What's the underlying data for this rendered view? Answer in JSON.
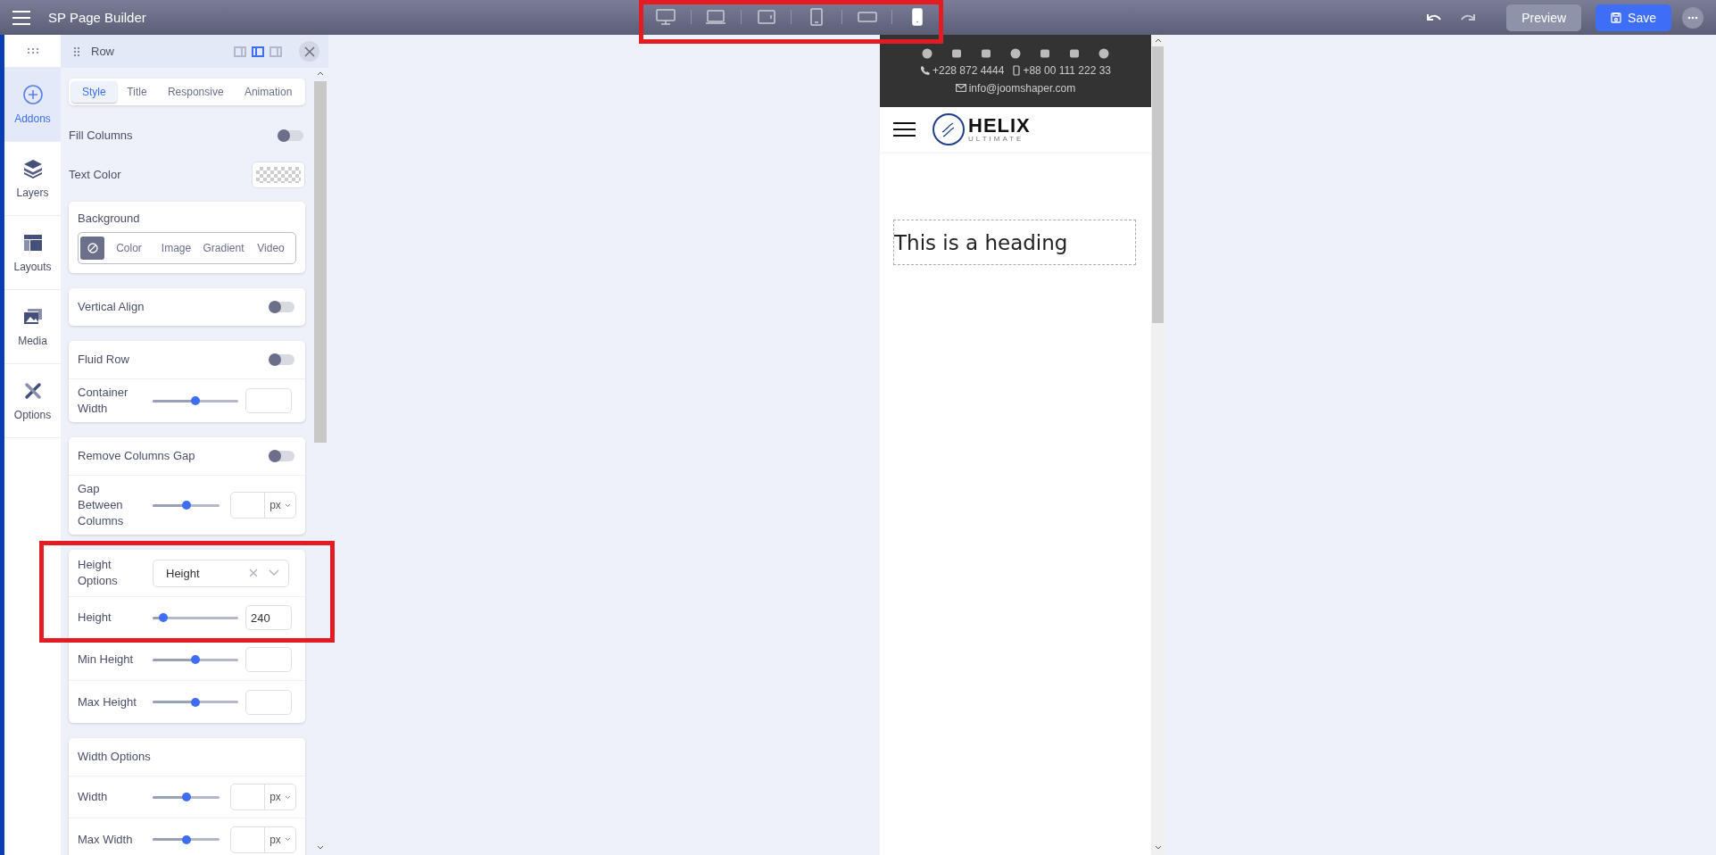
{
  "topbar": {
    "title": "SP Page Builder",
    "devices": [
      {
        "kind": "desktop",
        "selected": false
      },
      {
        "kind": "laptop",
        "selected": false
      },
      {
        "kind": "tablet-landscape",
        "selected": false
      },
      {
        "kind": "tablet",
        "selected": false
      },
      {
        "kind": "phone-landscape",
        "selected": false
      },
      {
        "kind": "phone",
        "selected": true
      }
    ],
    "preview": "Preview",
    "save": "Save",
    "highlighted": true
  },
  "rail": [
    {
      "label": "Addons",
      "selected": true
    },
    {
      "label": "Layers",
      "selected": false
    },
    {
      "label": "Layouts",
      "selected": false
    },
    {
      "label": "Media",
      "selected": false
    },
    {
      "label": "Options",
      "selected": false
    }
  ],
  "panel": {
    "title": "Row",
    "view_modes": [
      {
        "selected": false
      },
      {
        "selected": true
      },
      {
        "selected": false
      }
    ],
    "tabs": [
      {
        "label": "Style",
        "selected": true
      },
      {
        "label": "Title",
        "selected": false
      },
      {
        "label": "Responsive",
        "selected": false
      },
      {
        "label": "Animation",
        "selected": false
      }
    ],
    "rows": [
      {
        "kind": "toggle",
        "label": "Fill Columns",
        "on": false
      },
      {
        "kind": "color",
        "label": "Text Color"
      }
    ],
    "cards": [
      {
        "highlighted": false,
        "rows": [
          {
            "kind": "segment",
            "label": "Background",
            "options": [
              {
                "kind": "icon",
                "selected": true
              },
              {
                "kind": "text",
                "label": "Color",
                "selected": false
              },
              {
                "kind": "text",
                "label": "Image",
                "selected": false
              },
              {
                "kind": "text",
                "label": "Gradient",
                "selected": false
              },
              {
                "kind": "text",
                "label": "Video",
                "selected": false
              }
            ]
          }
        ]
      },
      {
        "highlighted": false,
        "rows": [
          {
            "kind": "toggle",
            "label": "Vertical Align",
            "on": false
          }
        ]
      },
      {
        "highlighted": false,
        "rows": [
          {
            "kind": "toggle",
            "label": "Fluid Row",
            "on": false
          },
          {
            "kind": "slider",
            "label": "Container Width",
            "level": 0.5
          }
        ]
      },
      {
        "highlighted": false,
        "rows": [
          {
            "kind": "toggle",
            "label": "Remove Columns Gap",
            "on": false
          },
          {
            "kind": "slider",
            "label": "Gap Between Columns",
            "level": 0.5,
            "unit": "px"
          }
        ]
      },
      {
        "highlighted": true,
        "rows": [
          {
            "kind": "select",
            "label": "Height Options",
            "value": "Height"
          },
          {
            "kind": "slider",
            "label": "Height",
            "level": 0.12,
            "value": "240"
          },
          {
            "kind": "slider",
            "label": "Min Height",
            "level": 0.5
          },
          {
            "kind": "slider",
            "label": "Max Height",
            "level": 0.5
          }
        ]
      },
      {
        "highlighted": false,
        "rows": [
          {
            "kind": "heading",
            "label": "Width Options"
          },
          {
            "kind": "slider",
            "label": "Width",
            "level": 0.5,
            "unit": "px"
          },
          {
            "kind": "slider",
            "label": "Max Width",
            "level": 0.5,
            "unit": "px"
          }
        ]
      }
    ]
  },
  "site": {
    "phone": "+228 872 4444",
    "mobile": "+88 00 111 222 33",
    "email": "info@joomshaper.com",
    "logo_name": "HELIX",
    "logo_tagline": "ULTIMATE",
    "heading": "This is a heading"
  }
}
